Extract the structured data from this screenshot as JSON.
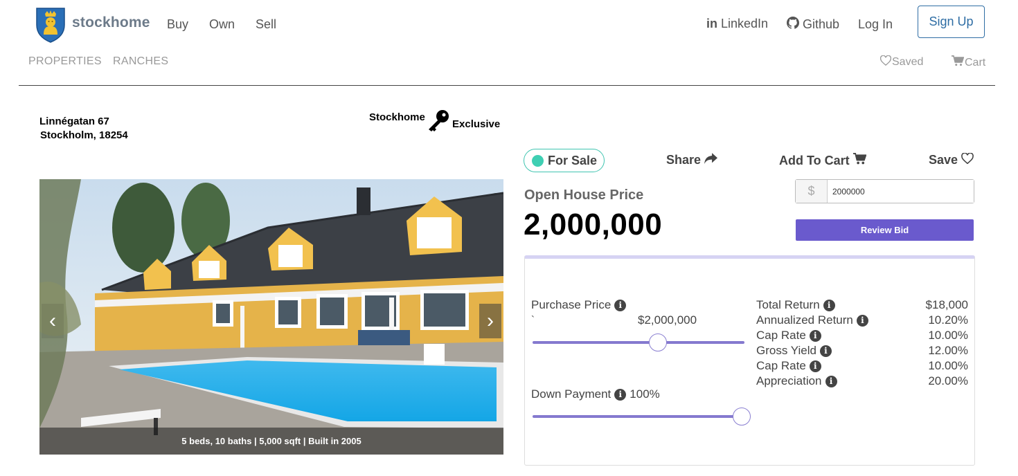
{
  "navbar": {
    "brand": "stockhome",
    "links": {
      "buy": "Buy",
      "own": "Own",
      "sell": "Sell"
    },
    "external": {
      "linkedin": "LinkedIn",
      "github": "Github"
    },
    "login": "Log In",
    "signup": "Sign Up"
  },
  "subnav": {
    "properties": "PROPERTIES",
    "ranches": "RANCHES",
    "saved": "Saved",
    "cart": "Cart"
  },
  "listing": {
    "address_line1": "Linnégatan 67",
    "address_line2": "Stockholm, 18254",
    "exclusive_word1": "Stockhome",
    "exclusive_word2": "Exclusive",
    "caption": "5 beds, 10 baths | 5,000 sqft | Built in 2005"
  },
  "status": {
    "label": "For Sale",
    "color": "#3fcfb3"
  },
  "actions": {
    "share": "Share",
    "add_to_cart": "Add To Cart",
    "save": "Save"
  },
  "price": {
    "label": "Open House Price",
    "value": "2,000,000"
  },
  "bid": {
    "currency_symbol": "$",
    "value": "2000000",
    "review_label": "Review Bid",
    "button_color": "#6a5acd"
  },
  "calculator": {
    "purchase_price_label": "Purchase Price",
    "tick_mark": "`",
    "purchase_price_value": "$2,000,000",
    "purchase_slider_fraction": 0.59,
    "down_payment_label": "Down Payment",
    "down_payment_value": "100%",
    "down_payment_slider_fraction": 1.0,
    "returns": [
      {
        "label": "Total Return",
        "value": "$18,000"
      },
      {
        "label": "Annualized Return",
        "value": "10.20%"
      },
      {
        "label": "Cap Rate",
        "value": "10.00%"
      },
      {
        "label": "Gross Yield",
        "value": "12.00%"
      },
      {
        "label": "Cap Rate",
        "value": "10.00%"
      },
      {
        "label": "Appreciation",
        "value": "20.00%"
      }
    ]
  },
  "icons": {
    "logo": "stockholm-crest-icon",
    "linkedin": "linkedin-icon",
    "github": "github-icon",
    "heart": "heart-icon",
    "cart": "cart-icon",
    "key": "key-icon",
    "share": "share-icon",
    "info": "info-icon"
  }
}
